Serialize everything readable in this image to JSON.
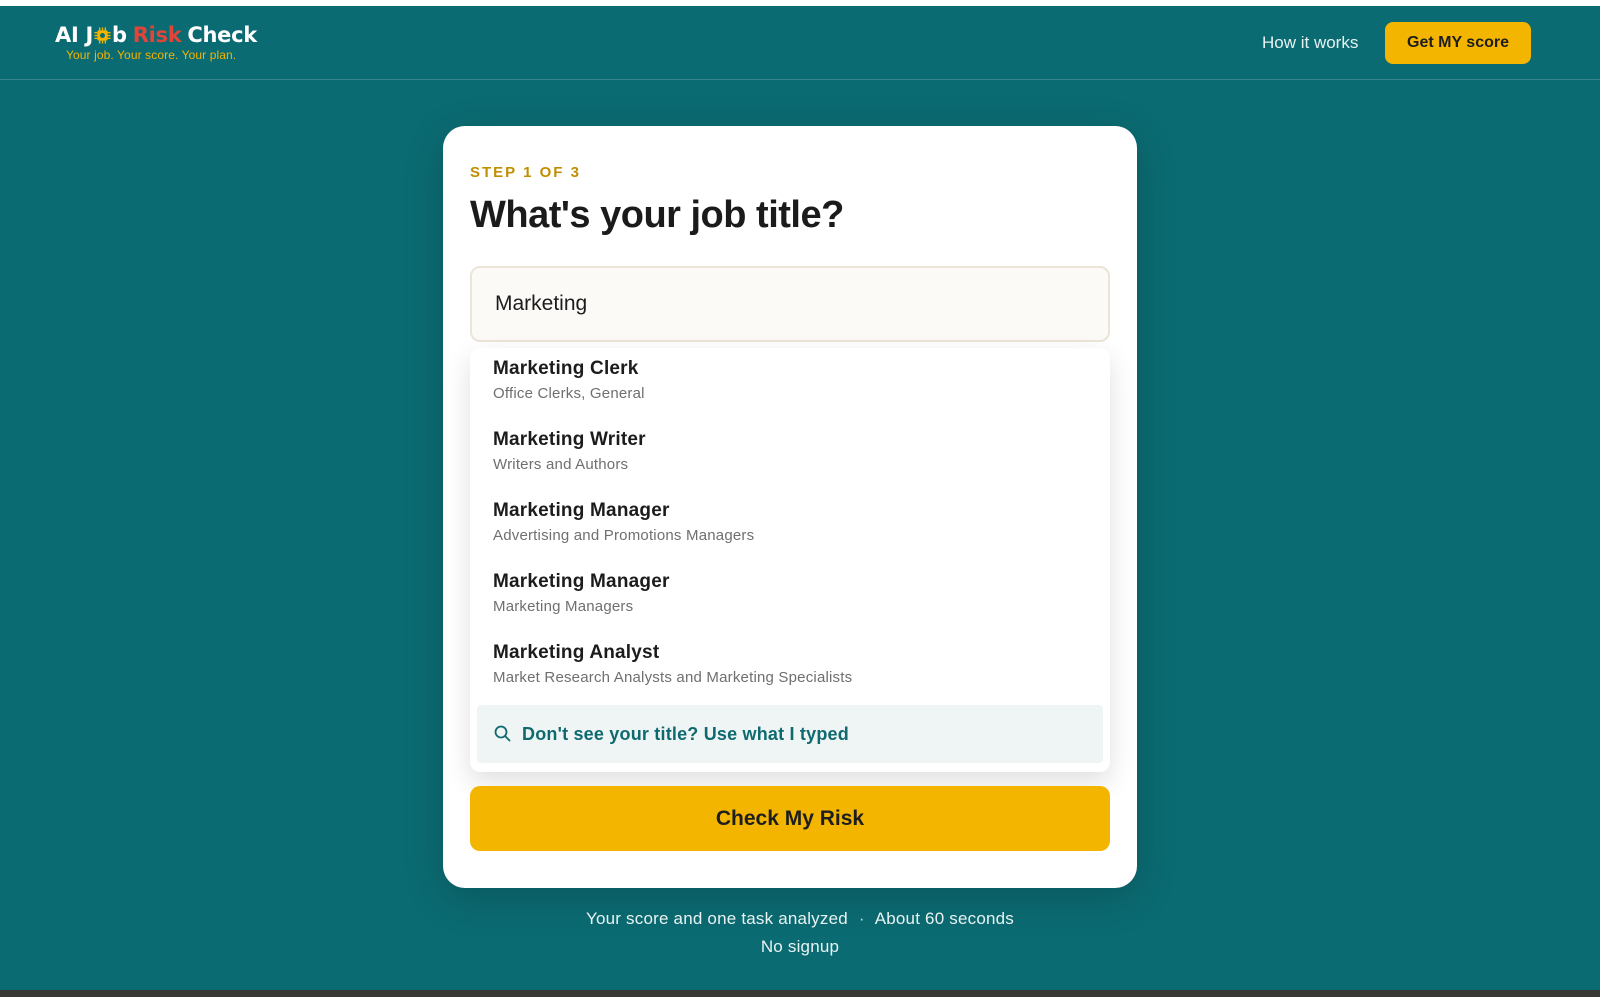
{
  "header": {
    "logo": {
      "part1": "AI J",
      "part2": "b",
      "risk": "Risk",
      "check": "Check",
      "tagline": "Your job. Your score. Your plan."
    },
    "nav_link": "How it works",
    "cta": "Get MY score"
  },
  "card": {
    "step": "STEP 1 OF 3",
    "question": "What's your job title?",
    "input_value": "Marketing",
    "suggestions": [
      {
        "title": "Marketing Clerk",
        "category": "Office Clerks, General"
      },
      {
        "title": "Marketing Writer",
        "category": "Writers and Authors"
      },
      {
        "title": "Marketing Manager",
        "category": "Advertising and Promotions Managers"
      },
      {
        "title": "Marketing Manager",
        "category": "Marketing Managers"
      },
      {
        "title": "Marketing Analyst",
        "category": "Market Research Analysts and Marketing Specialists"
      }
    ],
    "use_typed": "Don't see your title? Use what I typed",
    "submit": "Check My Risk"
  },
  "footer": {
    "line1_a": "Your score and one task analyzed",
    "separator": "·",
    "line1_b": "About 60 seconds",
    "line2": "No signup"
  },
  "colors": {
    "background": "#0b6b72",
    "accent": "#f3b500",
    "risk_red": "#e2443a",
    "step_gold": "#c08f00",
    "link_teal": "#0f6a70"
  },
  "icons": {
    "logo_chip": "chip-icon",
    "use_typed": "search-icon"
  }
}
